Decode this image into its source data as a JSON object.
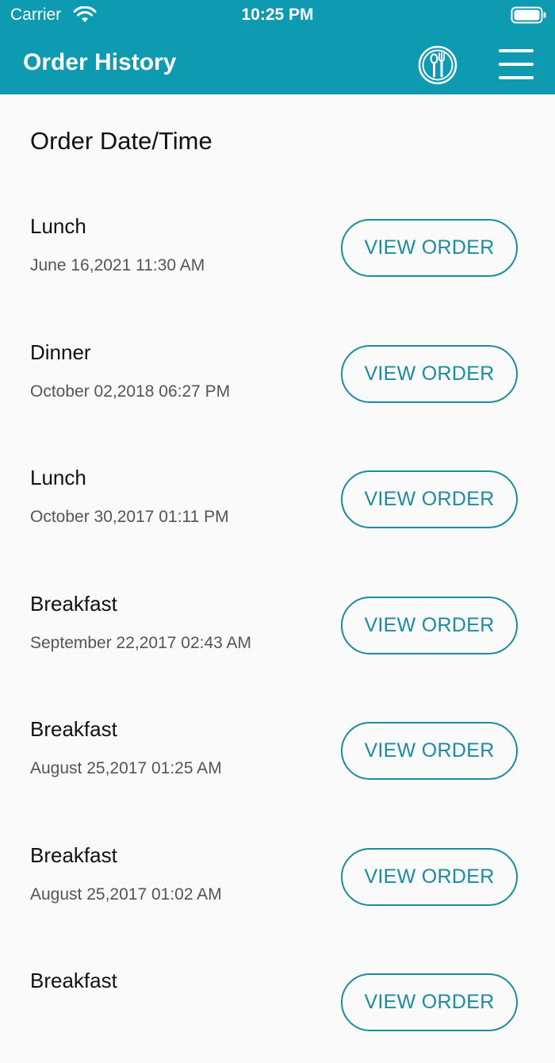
{
  "status_bar": {
    "carrier": "Carrier",
    "time": "10:25 PM",
    "icons": [
      "wifi-icon",
      "battery-icon"
    ]
  },
  "nav": {
    "title": "Order History",
    "icons": [
      "dining-icon",
      "menu-icon"
    ]
  },
  "colors": {
    "header_bg": "#0e9ab0",
    "accent": "#1b8ca0",
    "page_bg": "#fafafa"
  },
  "section": {
    "header": "Order Date/Time"
  },
  "orders": [
    {
      "meal": "Lunch",
      "datetime": "June 16,2021 11:30 AM",
      "action": "VIEW ORDER"
    },
    {
      "meal": "Dinner",
      "datetime": "October 02,2018 06:27 PM",
      "action": "VIEW ORDER"
    },
    {
      "meal": "Lunch",
      "datetime": "October 30,2017 01:11 PM",
      "action": "VIEW ORDER"
    },
    {
      "meal": "Breakfast",
      "datetime": "September 22,2017 02:43 AM",
      "action": "VIEW ORDER"
    },
    {
      "meal": "Breakfast",
      "datetime": "August 25,2017 01:25 AM",
      "action": "VIEW ORDER"
    },
    {
      "meal": "Breakfast",
      "datetime": "August 25,2017 01:02 AM",
      "action": "VIEW ORDER"
    },
    {
      "meal": "Breakfast",
      "datetime": "",
      "action": "VIEW ORDER"
    }
  ]
}
